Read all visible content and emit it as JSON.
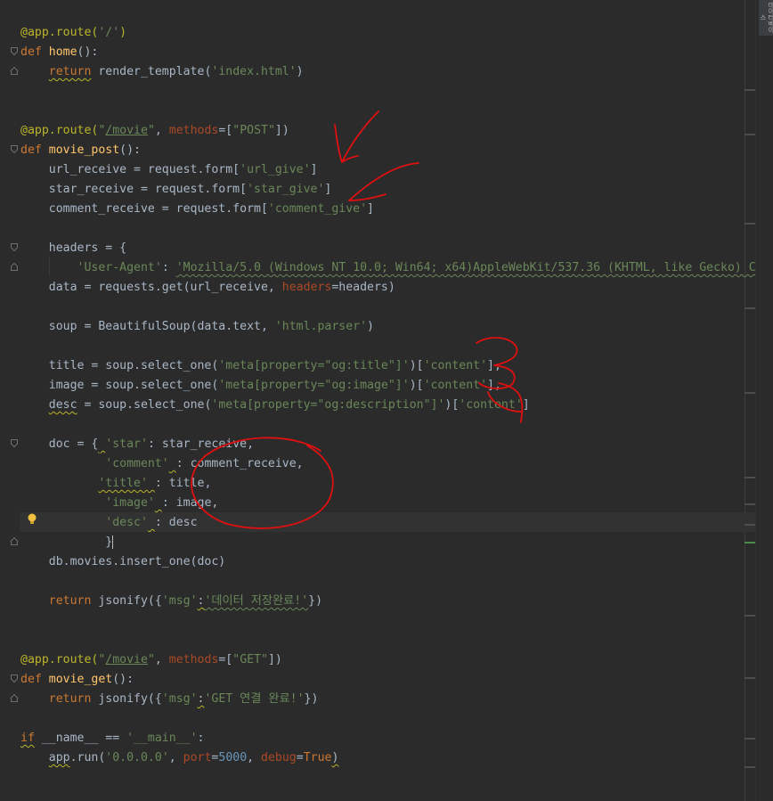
{
  "editor": {
    "lines": [
      [
        {
          "t": "@app.route(",
          "c": "dec"
        },
        {
          "t": "'/'",
          "c": "str"
        },
        {
          "t": ")",
          "c": "dec"
        }
      ],
      [
        {
          "t": "def ",
          "c": "kw"
        },
        {
          "t": "home",
          "c": "fn"
        },
        {
          "t": "():",
          "c": "plain"
        }
      ],
      [
        {
          "t": "    ",
          "c": "plain"
        },
        {
          "t": "return",
          "c": "kw",
          "u": "wavy-y"
        },
        {
          "t": " render_template(",
          "c": "plain"
        },
        {
          "t": "'index.html'",
          "c": "str"
        },
        {
          "t": ")",
          "c": "plain"
        }
      ],
      [],
      [],
      [
        {
          "t": "@app.route(",
          "c": "dec"
        },
        {
          "t": "\"",
          "c": "str"
        },
        {
          "t": "/movie",
          "c": "str",
          "u": "ul"
        },
        {
          "t": "\"",
          "c": "str"
        },
        {
          "t": ", ",
          "c": "plain"
        },
        {
          "t": "methods",
          "c": "param"
        },
        {
          "t": "=[",
          "c": "plain"
        },
        {
          "t": "\"POST\"",
          "c": "str"
        },
        {
          "t": "])",
          "c": "plain"
        }
      ],
      [
        {
          "t": "def ",
          "c": "kw"
        },
        {
          "t": "movie_post",
          "c": "fn"
        },
        {
          "t": "():",
          "c": "plain"
        }
      ],
      [
        {
          "t": "    url_receive = request.form[",
          "c": "plain"
        },
        {
          "t": "'url_give'",
          "c": "str"
        },
        {
          "t": "]",
          "c": "plain"
        }
      ],
      [
        {
          "t": "    star_receive = request.form[",
          "c": "plain"
        },
        {
          "t": "'star_give'",
          "c": "str"
        },
        {
          "t": "]",
          "c": "plain"
        }
      ],
      [
        {
          "t": "    comment_receive = request.form[",
          "c": "plain"
        },
        {
          "t": "'comment_give'",
          "c": "str"
        },
        {
          "t": "]",
          "c": "plain"
        }
      ],
      [],
      [
        {
          "t": "    headers = {",
          "c": "plain"
        }
      ],
      [
        {
          "t": "        ",
          "c": "plain"
        },
        {
          "t": "'User-Agent'",
          "c": "str"
        },
        {
          "t": ": ",
          "c": "plain"
        },
        {
          "t": "'Mozilla/5.0 (Windows NT 10.0; Win64; x64)AppleWebKit/537.36 (KHTML, like Gecko) C",
          "c": "str",
          "u": "wavy"
        }
      ],
      [
        {
          "t": "    data = requests.get(url_receive, ",
          "c": "plain"
        },
        {
          "t": "headers",
          "c": "param"
        },
        {
          "t": "=headers)",
          "c": "plain"
        }
      ],
      [],
      [
        {
          "t": "    soup = BeautifulSoup(data.text, ",
          "c": "plain"
        },
        {
          "t": "'html.parser'",
          "c": "str"
        },
        {
          "t": ")",
          "c": "plain"
        }
      ],
      [],
      [
        {
          "t": "    title = soup.select_one(",
          "c": "plain"
        },
        {
          "t": "'meta[property=\"og:title\"]'",
          "c": "str"
        },
        {
          "t": ")[",
          "c": "plain"
        },
        {
          "t": "'content'",
          "c": "str"
        },
        {
          "t": "],",
          "c": "plain"
        }
      ],
      [
        {
          "t": "    image = soup.select_one(",
          "c": "plain"
        },
        {
          "t": "'meta[property=\"og:image\"]'",
          "c": "str"
        },
        {
          "t": ")[",
          "c": "plain"
        },
        {
          "t": "'content'",
          "c": "str"
        },
        {
          "t": "],",
          "c": "plain"
        }
      ],
      [
        {
          "t": "    ",
          "c": "plain"
        },
        {
          "t": "desc",
          "c": "plain",
          "u": "wavy-y"
        },
        {
          "t": " = soup.select_one(",
          "c": "plain"
        },
        {
          "t": "'meta[property=\"og:description\"]'",
          "c": "str"
        },
        {
          "t": ")[",
          "c": "plain"
        },
        {
          "t": "'content'",
          "c": "str"
        },
        {
          "t": "]",
          "c": "plain"
        }
      ],
      [],
      [
        {
          "t": "    doc = {",
          "c": "plain"
        },
        {
          "t": " ",
          "c": "plain",
          "u": "wavy-y"
        },
        {
          "t": "'star'",
          "c": "str"
        },
        {
          "t": ": star_receive,",
          "c": "plain"
        }
      ],
      [
        {
          "t": "            ",
          "c": "plain"
        },
        {
          "t": "'comment'",
          "c": "str"
        },
        {
          "t": " ",
          "c": "plain",
          "u": "wavy-y"
        },
        {
          "t": ": comment_receive,",
          "c": "plain"
        }
      ],
      [
        {
          "t": "           ",
          "c": "plain"
        },
        {
          "t": "'title'",
          "c": "str",
          "u": "wavy-y"
        },
        {
          "t": " ",
          "c": "plain",
          "u": "wavy-y"
        },
        {
          "t": ": title,",
          "c": "plain"
        }
      ],
      [
        {
          "t": "            ",
          "c": "plain"
        },
        {
          "t": "'image'",
          "c": "str"
        },
        {
          "t": " ",
          "c": "plain",
          "u": "wavy-y"
        },
        {
          "t": ": image,",
          "c": "plain"
        }
      ],
      [
        {
          "t": "            ",
          "c": "plain"
        },
        {
          "t": "'desc'",
          "c": "str"
        },
        {
          "t": " ",
          "c": "plain",
          "u": "wavy-y"
        },
        {
          "t": ": desc",
          "c": "plain"
        }
      ],
      [
        {
          "t": "            }",
          "c": "plain"
        }
      ],
      [
        {
          "t": "    db.movies.insert_one(doc)",
          "c": "plain"
        }
      ],
      [],
      [
        {
          "t": "    ",
          "c": "plain"
        },
        {
          "t": "return",
          "c": "kw"
        },
        {
          "t": " jsonify({",
          "c": "plain"
        },
        {
          "t": "'msg'",
          "c": "str"
        },
        {
          "t": ":",
          "c": "plain",
          "u": "wavy-y"
        },
        {
          "t": "'데이터 저장완료!'",
          "c": "str",
          "u": "wavy"
        },
        {
          "t": "})",
          "c": "plain"
        }
      ],
      [],
      [],
      [
        {
          "t": "@app.route(",
          "c": "dec"
        },
        {
          "t": "\"",
          "c": "str"
        },
        {
          "t": "/movie",
          "c": "str",
          "u": "ul"
        },
        {
          "t": "\"",
          "c": "str"
        },
        {
          "t": ", ",
          "c": "plain"
        },
        {
          "t": "methods",
          "c": "param"
        },
        {
          "t": "=[",
          "c": "plain"
        },
        {
          "t": "\"GET\"",
          "c": "str"
        },
        {
          "t": "])",
          "c": "plain"
        }
      ],
      [
        {
          "t": "def ",
          "c": "kw"
        },
        {
          "t": "movie_get",
          "c": "fn"
        },
        {
          "t": "():",
          "c": "plain"
        }
      ],
      [
        {
          "t": "    ",
          "c": "plain"
        },
        {
          "t": "return",
          "c": "kw"
        },
        {
          "t": " jsonify({",
          "c": "plain"
        },
        {
          "t": "'msg'",
          "c": "str"
        },
        {
          "t": ":",
          "c": "plain",
          "u": "wavy-y"
        },
        {
          "t": "'GET 연결 완료!'",
          "c": "str"
        },
        {
          "t": "})",
          "c": "plain"
        }
      ],
      [],
      [
        {
          "t": "if",
          "c": "kw",
          "u": "wavy-y"
        },
        {
          "t": " __name__ == ",
          "c": "plain"
        },
        {
          "t": "'__main__'",
          "c": "str"
        },
        {
          "t": ":",
          "c": "plain"
        }
      ],
      [
        {
          "t": "    ",
          "c": "plain"
        },
        {
          "t": "app",
          "c": "plain",
          "u": "wavy-y"
        },
        {
          "t": ".run(",
          "c": "plain"
        },
        {
          "t": "'0.0.0.0'",
          "c": "str"
        },
        {
          "t": ", ",
          "c": "plain"
        },
        {
          "t": "port",
          "c": "param"
        },
        {
          "t": "=",
          "c": "plain"
        },
        {
          "t": "5000",
          "c": "num"
        },
        {
          "t": ", ",
          "c": "plain"
        },
        {
          "t": "debug",
          "c": "param"
        },
        {
          "t": "=",
          "c": "plain"
        },
        {
          "t": "True",
          "c": "kw"
        },
        {
          "t": ")",
          "c": "plain",
          "u": "wavy-y"
        }
      ]
    ],
    "caret_line": 26
  },
  "side_tab": {
    "label": "데이터베이스"
  },
  "colors": {
    "background": "#2b2b2b",
    "annotation": "#e01010"
  }
}
